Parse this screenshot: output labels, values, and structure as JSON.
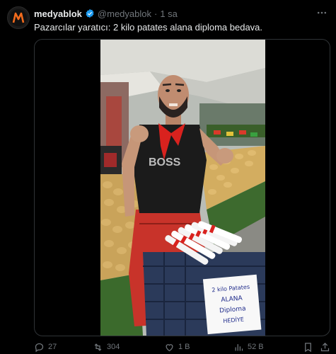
{
  "tweet": {
    "author_name": "medyablok",
    "author_handle": "@medyablok",
    "separator": "·",
    "time": "1 sa",
    "text": "Pazarcılar yaratıcı: 2 kilo patates alana diploma bedava."
  },
  "media": {
    "sign_lines": [
      "2 kilo Patates",
      "ALANA",
      "Diploma",
      "HEDİYE"
    ],
    "shirt_text": "BOSS"
  },
  "actions": {
    "replies": "27",
    "retweets": "304",
    "likes": "1 B",
    "views": "52 B"
  },
  "colors": {
    "background": "#000000",
    "text": "#e7e9ea",
    "muted": "#71767b",
    "verified": "#1d9bf0",
    "avatar_accent": "#f26b1d"
  },
  "icons": [
    "logo-icon",
    "verified-icon",
    "more-icon",
    "reply-icon",
    "retweet-icon",
    "like-icon",
    "views-icon",
    "bookmark-icon",
    "share-icon"
  ]
}
